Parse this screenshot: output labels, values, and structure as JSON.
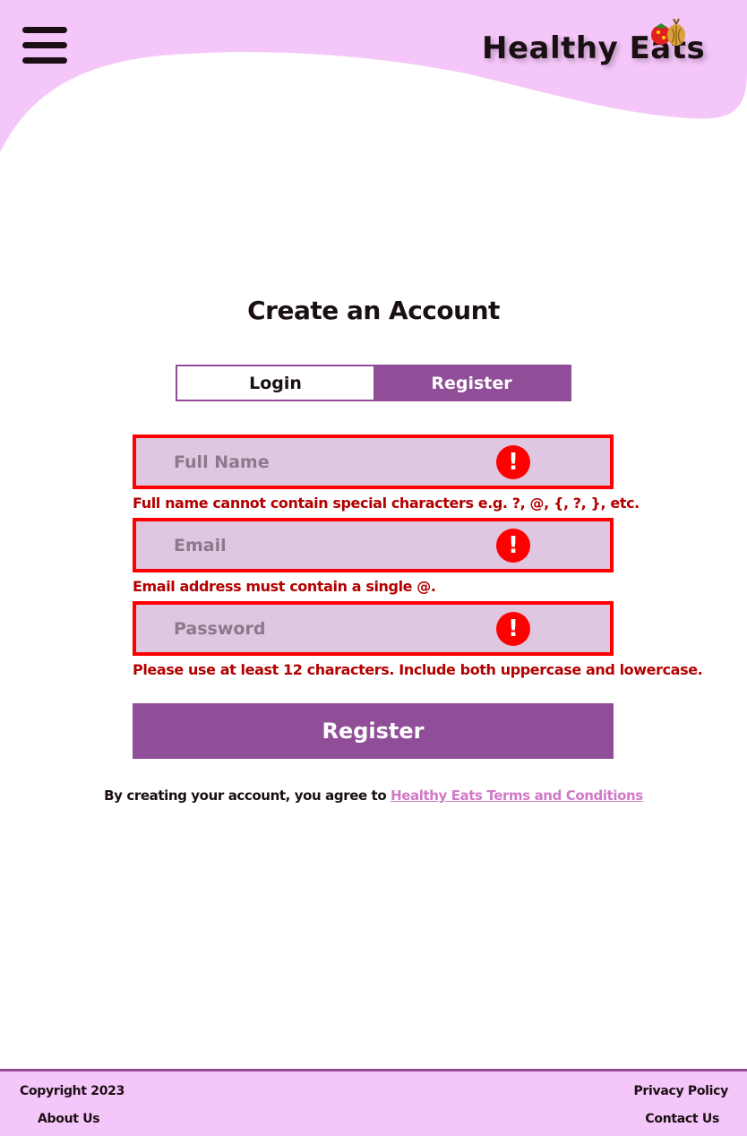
{
  "colors": {
    "header_bg": "#f5c6f9",
    "accent": "#914e98",
    "error": "#ff0000",
    "error_text": "#b30000",
    "field_bg": "#dfc6e1",
    "link": "#d07ac8"
  },
  "header": {
    "menu_icon": "hamburger-menu-icon",
    "logo_text": "Healthy Eats",
    "logo_icon": "vegetables-icon"
  },
  "page": {
    "title": "Create an Account"
  },
  "tabs": [
    {
      "label": "Login",
      "active": false
    },
    {
      "label": "Register",
      "active": true
    }
  ],
  "form": {
    "fields": [
      {
        "placeholder": "Full Name",
        "value": "",
        "error": "Full name cannot contain special characters e.g.  ?, @, {, ?, }, etc."
      },
      {
        "placeholder": "Email",
        "value": "",
        "error": "Email address must contain a single @."
      },
      {
        "placeholder": "Password",
        "value": "",
        "error": "Please use at least 12 characters. Include both uppercase and lowercase."
      }
    ],
    "error_icon_symbol": "!",
    "submit_label": "Register"
  },
  "terms": {
    "text": "By creating your account, you agree to",
    "link": "Healthy Eats Terms and Conditions"
  },
  "footer": {
    "copyright": "Copyright 2023",
    "about": "About Us",
    "privacy": "Privacy Policy",
    "contact": "Contact Us"
  }
}
